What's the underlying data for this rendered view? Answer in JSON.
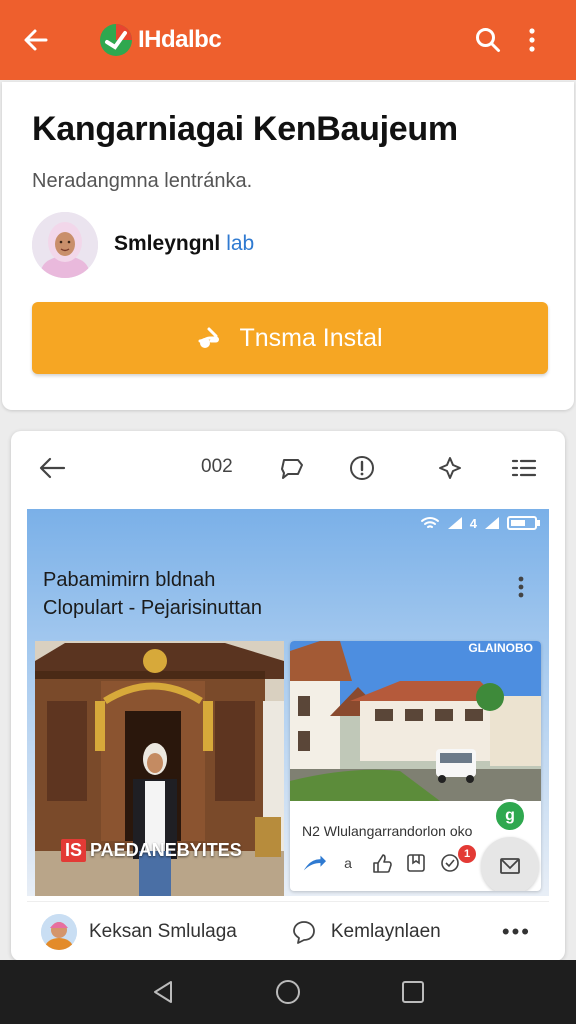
{
  "appbar": {
    "brand": "IHdalbc",
    "icons": [
      "back-arrow-icon",
      "brand-logo-icon",
      "search-icon",
      "more-vertical-icon"
    ]
  },
  "header": {
    "title": "Kangarniagai KenBaujeum",
    "subtitle": "Neradangmna lentránka.",
    "author_name": "Smleyngnl",
    "author_tag": "lab",
    "install_label": "Tnsma Instal"
  },
  "preview": {
    "toolbar": {
      "count": "002",
      "icons": [
        "back-arrow-icon",
        "chat-icon",
        "info-icon",
        "sparkle-icon",
        "list-icon"
      ]
    },
    "status_icons": [
      "wifi-icon",
      "signal-icon",
      "signal-icon",
      "battery-icon"
    ],
    "status_text": "4",
    "header_line1": "Pabamimirn bldnah",
    "header_line2": "Clopulart - Pejarisinuttan",
    "tile1": {
      "badge": "IS",
      "label": "PAEDANEBYITES"
    },
    "tile2": {
      "corner_text": "GLAINOBO",
      "caption": "N2 Wlulangarrandorlon oko",
      "action_count": "a",
      "bubble": "g",
      "notif": "1"
    },
    "footer": {
      "name": "Keksan Smlulaga",
      "comment_label": "Kemlaynlaen",
      "more": "•••"
    }
  },
  "navbar": {
    "icons": [
      "nav-back-icon",
      "nav-home-icon",
      "nav-recents-icon"
    ]
  },
  "colors": {
    "appbar": "#ee5f2d",
    "install": "#f6a623",
    "author_tag": "#2f7ad1",
    "navbar": "#1e1e1e"
  }
}
